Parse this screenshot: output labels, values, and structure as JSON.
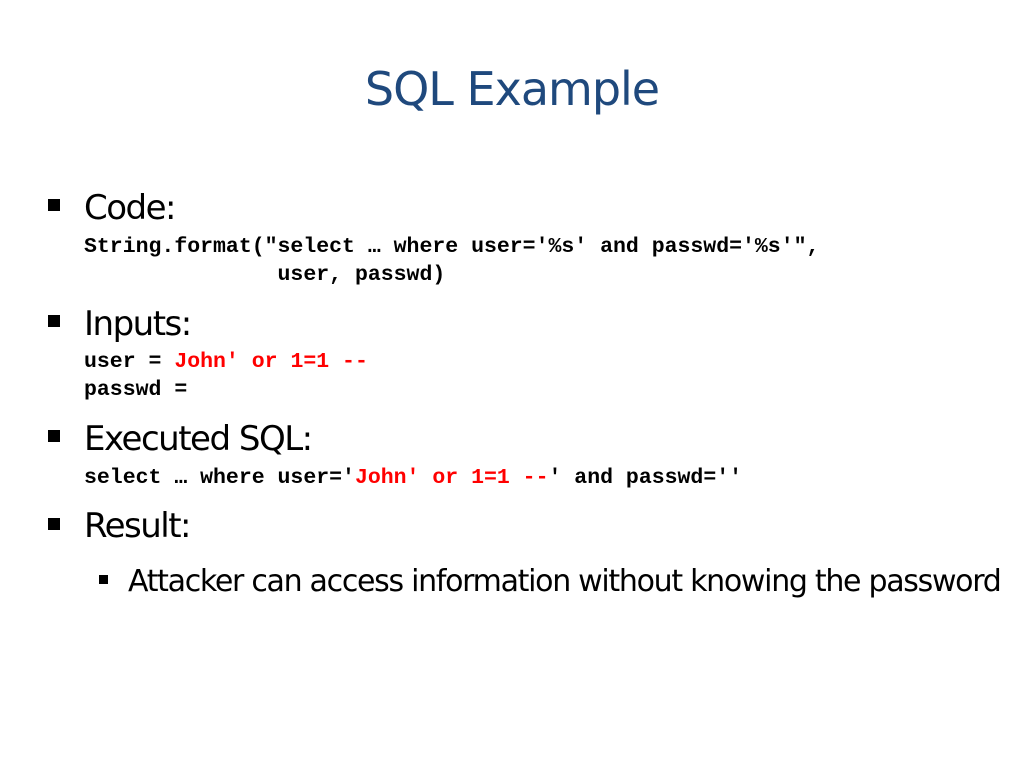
{
  "slide": {
    "title": "SQL Example",
    "sections": {
      "code": {
        "heading": "Code:",
        "line1": "String.format(\"select … where user='%s' and passwd='%s'\",",
        "line2": "               user, passwd)"
      },
      "inputs": {
        "heading": "Inputs:",
        "user_label": "user = ",
        "user_value": "John' or 1=1 --",
        "passwd_label": "passwd ="
      },
      "executed_sql": {
        "heading": "Executed SQL:",
        "prefix": "select … where user='",
        "injected": "John' or 1=1 --",
        "suffix": "' and passwd=''"
      },
      "result": {
        "heading": "Result:",
        "items": [
          "Attacker can access information without knowing the password"
        ]
      }
    },
    "colors": {
      "title": "#1f497d",
      "injection": "#ff0000"
    }
  }
}
